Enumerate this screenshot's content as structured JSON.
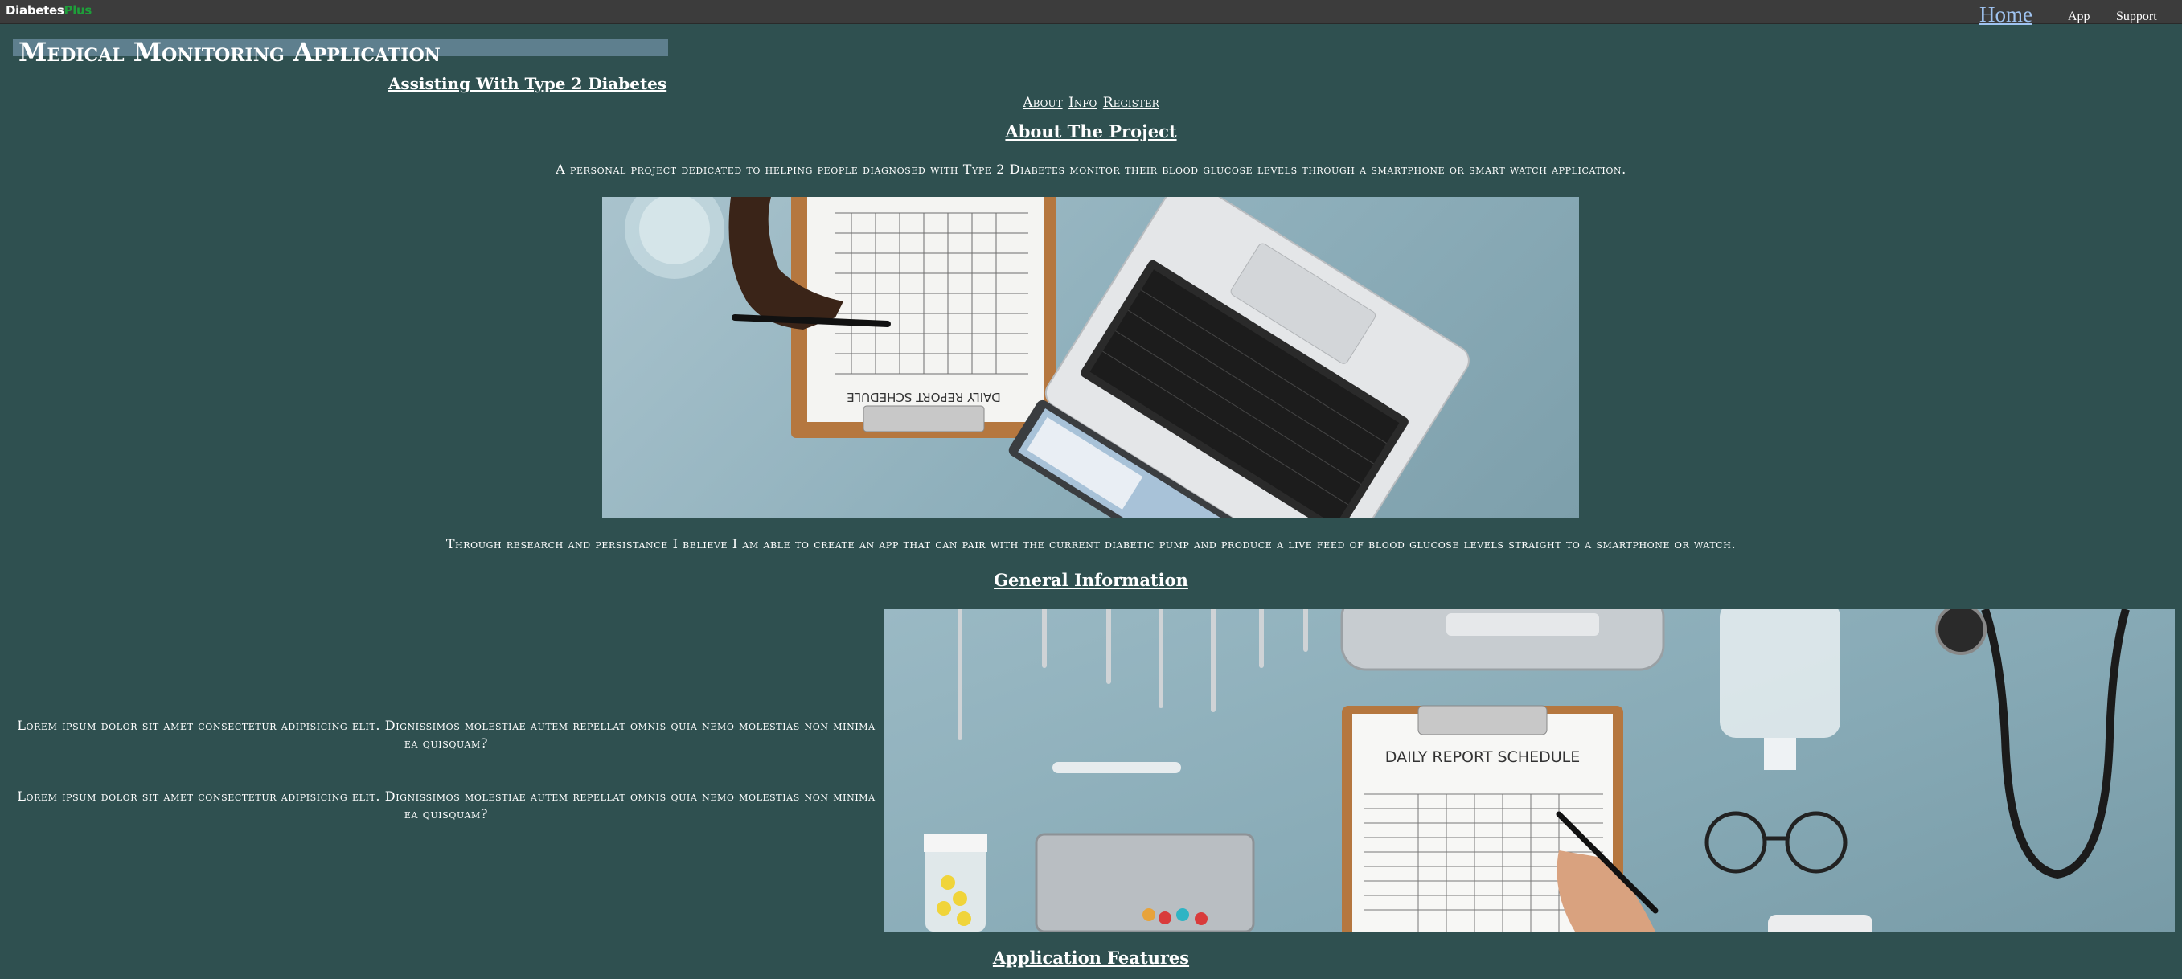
{
  "brand": {
    "part1": "Diabetes",
    "part2": "Plus"
  },
  "nav": {
    "home": "Home",
    "app": "App",
    "support": "Support"
  },
  "header": {
    "title": "Medical Monitoring Application",
    "subtitle": "Assisting With Type 2 Diabetes"
  },
  "links": {
    "about": "About",
    "info": "Info",
    "register": "Register"
  },
  "about": {
    "heading": "About The Project",
    "intro": "A personal project dedicated to helping people diagnosed with Type 2 Diabetes monitor their blood glucose levels through a smartphone or smart watch application.",
    "research": "Through research and persistance I believe I am able to create an app that can pair with the current diabetic pump and produce a live feed of blood glucose levels straight to a smartphone or watch.",
    "photo_clipboard_text": "DAILY REPORT SCHEDULE"
  },
  "info": {
    "heading": "General Information",
    "paragraphs": [
      "Lorem ipsum dolor sit amet consectetur adipisicing elit. Dignissimos molestiae autem repellat omnis quia nemo molestias non minima ea quisquam?",
      "Lorem ipsum dolor sit amet consectetur adipisicing elit. Dignissimos molestiae autem repellat omnis quia nemo molestias non minima ea quisquam?"
    ],
    "photo_clipboard_text": "DAILY REPORT SCHEDULE"
  },
  "features": {
    "heading": "Application Features"
  }
}
